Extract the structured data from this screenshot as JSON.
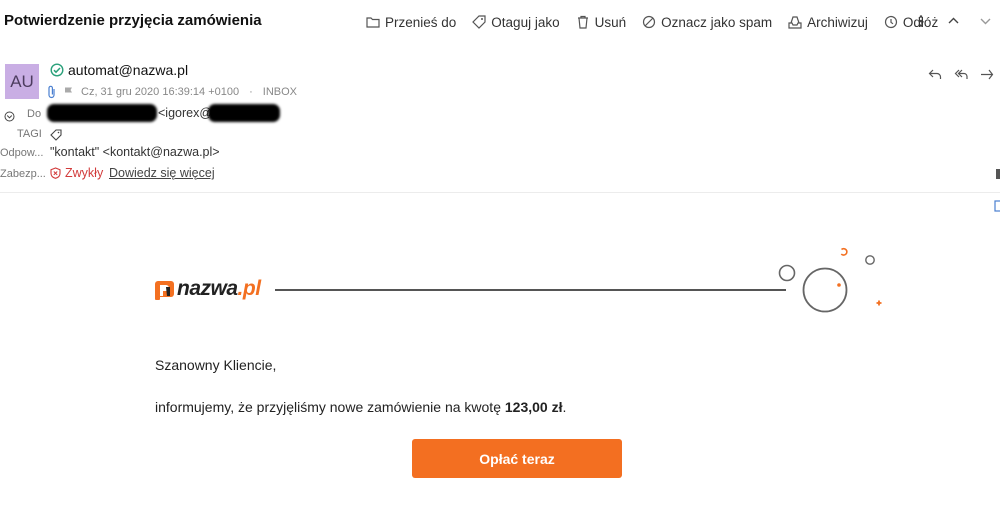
{
  "subject": "Potwierdzenie przyjęcia zamówienia",
  "toolbar": {
    "move": "Przenieś do",
    "tag": "Otaguj jako",
    "delete": "Usuń",
    "spam": "Oznacz jako spam",
    "archive": "Archiwizuj",
    "snooze": "Odłóż"
  },
  "message": {
    "avatar_initials": "AU",
    "from": "automat@nazwa.pl",
    "date": "Cz, 31 gru 2020 16:39:14 +0100",
    "folder": "INBOX",
    "to_label": "Do",
    "to_value": "<igorex@",
    "tags_label": "TAGI",
    "reply_to_label": "Odpow...",
    "reply_to_value": "\"kontakt\" <kontakt@nazwa.pl>",
    "security_label": "Zabezp...",
    "security_value": "Zwykły",
    "learn_more": "Dowiedz się więcej"
  },
  "body": {
    "brand": "nazwa",
    "brand_dot": ".",
    "brand_tld": "pl",
    "greeting": "Szanowny Kliencie,",
    "info_before": "informujemy, że przyjęliśmy nowe zamówienie na kwotę ",
    "amount": "123,00 zł",
    "info_after": ".",
    "pay_button": "Opłać teraz"
  },
  "colors": {
    "accent": "#f36f21",
    "avatar": "#c9aee4",
    "verified": "#2aa07a",
    "security": "#d23a3a"
  }
}
